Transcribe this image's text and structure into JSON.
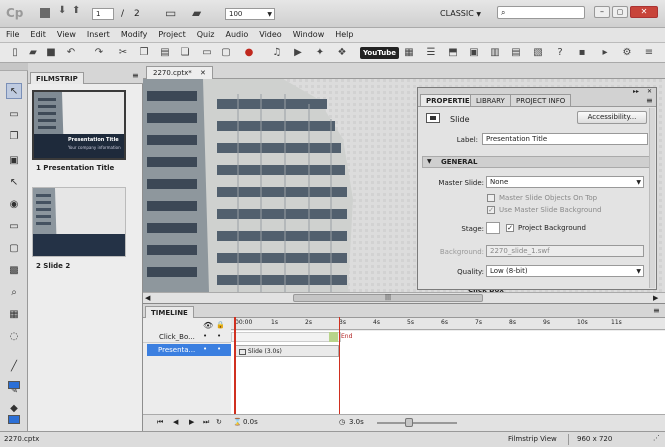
{
  "titlebar": {
    "logo": "Cp",
    "page_current": "1",
    "page_separator": "/",
    "page_total": "2",
    "zoom": "100",
    "workspace": "CLASSIC",
    "search_placeholder": ""
  },
  "menu": [
    "File",
    "Edit",
    "View",
    "Insert",
    "Modify",
    "Project",
    "Quiz",
    "Audio",
    "Video",
    "Window",
    "Help"
  ],
  "toolbar": {
    "youtube_label": "YouTube"
  },
  "filmstrip": {
    "tab_label": "FILMSTRIP",
    "slides": [
      {
        "title": "1 Presentation Title",
        "thumb_title": "Presentation Title",
        "thumb_subtitle": "Your company information"
      },
      {
        "title": "2 Slide 2"
      }
    ]
  },
  "document": {
    "tab_label": "2270.cptx*"
  },
  "stage": {
    "click_box_label": "Click Box"
  },
  "properties": {
    "tabs": [
      "PROPERTIES",
      "LIBRARY",
      "PROJECT INFO"
    ],
    "object_type": "Slide",
    "accessibility_button": "Accessibility...",
    "label_caption": "Label:",
    "label_value": "Presentation Title",
    "section_general": "GENERAL",
    "master_slide_caption": "Master Slide:",
    "master_slide_value": "None",
    "master_slide_objects_on_top": "Master Slide Objects On Top",
    "use_master_slide_background": "Use Master Slide Background",
    "stage_caption": "Stage:",
    "project_background": "Project Background",
    "background_caption": "Background:",
    "background_value": "2270_slide_1.swf",
    "quality_caption": "Quality:",
    "quality_value": "Low (8-bit)"
  },
  "timeline": {
    "tab_label": "TIMELINE",
    "layers": [
      "Click_Bo...",
      "Presenta..."
    ],
    "ruler_ticks": [
      "00:00",
      "1s",
      "2s",
      "3s",
      "4s",
      "5s",
      "6s",
      "7s",
      "8s",
      "9s",
      "10s",
      "11s"
    ],
    "end_label": "End",
    "slide_bar_label": "Slide (3.0s)",
    "time_start": "0.0s",
    "time_end": "3.0s"
  },
  "status": {
    "file": "2270.cptx",
    "view": "Filmstrip View",
    "dimensions": "960 x 720"
  },
  "colors": {
    "accent": "#2b6fd6",
    "selected_layer": "#3b7fe0",
    "playhead": "#d03020"
  }
}
